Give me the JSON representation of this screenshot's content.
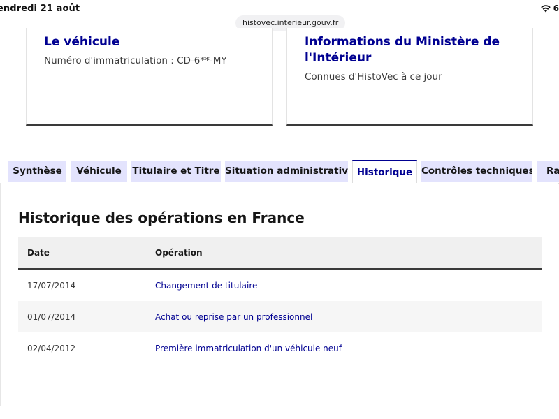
{
  "status_bar": {
    "date": "endredi 21 août",
    "url": "histovec.interieur.gouv.fr",
    "battery": "6"
  },
  "cards": {
    "vehicle": {
      "title": "Le véhicule",
      "plate_text": "Numéro d'immatriculation : CD-6**-MY"
    },
    "ministere": {
      "title": "Informations du Ministère de l'Intérieur",
      "subtitle": "Connues d'HistoVec à ce jour"
    }
  },
  "tabs": [
    {
      "label": "Synthèse",
      "active": false
    },
    {
      "label": "Véhicule",
      "active": false
    },
    {
      "label": "Titulaire et Titre",
      "active": false
    },
    {
      "label": "Situation administrative",
      "active": false
    },
    {
      "label": "Historique",
      "active": true
    },
    {
      "label": "Contrôles techniques",
      "active": false
    },
    {
      "label": "Rap",
      "active": false
    }
  ],
  "history": {
    "title": "Historique des opérations en France",
    "columns": {
      "date": "Date",
      "operation": "Opération"
    },
    "rows": [
      {
        "date": "17/07/2014",
        "operation": "Changement de titulaire"
      },
      {
        "date": "01/07/2014",
        "operation": "Achat ou reprise par un professionnel"
      },
      {
        "date": "02/04/2012",
        "operation": "Première immatriculation d'un véhicule neuf"
      }
    ]
  },
  "colors": {
    "accent": "#000091",
    "tab_bg": "#e3e3fd",
    "table_header_bg": "#f0f0f0"
  }
}
